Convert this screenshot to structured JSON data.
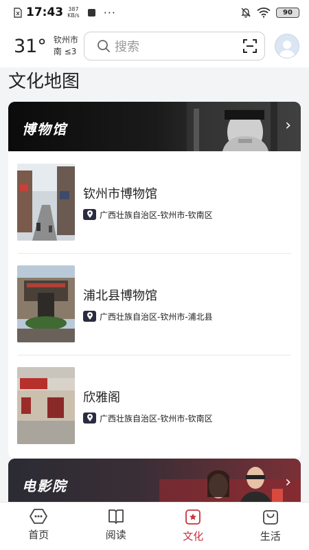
{
  "status_bar": {
    "time": "17:43",
    "net_speed_value": "387",
    "net_speed_unit": "KB/s",
    "more": "···",
    "battery": "90"
  },
  "header": {
    "temperature": "31°",
    "city": "钦州市",
    "wind": "南 ≤3",
    "search_placeholder": "搜索"
  },
  "page": {
    "title": "文化地图"
  },
  "sections": [
    {
      "banner_title": "博物馆",
      "items": [
        {
          "name": "钦州市博物馆",
          "location": "广西壮族自治区-钦州市-钦南区"
        },
        {
          "name": "浦北县博物馆",
          "location": "广西壮族自治区-钦州市-浦北县"
        },
        {
          "name": "欣雅阁",
          "location": "广西壮族自治区-钦州市-钦南区"
        }
      ]
    },
    {
      "banner_title": "电影院",
      "items": []
    }
  ],
  "tabbar": {
    "tabs": [
      {
        "label": "首页",
        "icon": "home-icon"
      },
      {
        "label": "阅读",
        "icon": "book-icon"
      },
      {
        "label": "文化",
        "icon": "culture-icon",
        "active": true
      },
      {
        "label": "生活",
        "icon": "shopping-bag-icon"
      }
    ]
  },
  "colors": {
    "accent": "#c8323c",
    "content_bg": "#f3f4f6",
    "location_icon_bg": "#2a2c40"
  }
}
